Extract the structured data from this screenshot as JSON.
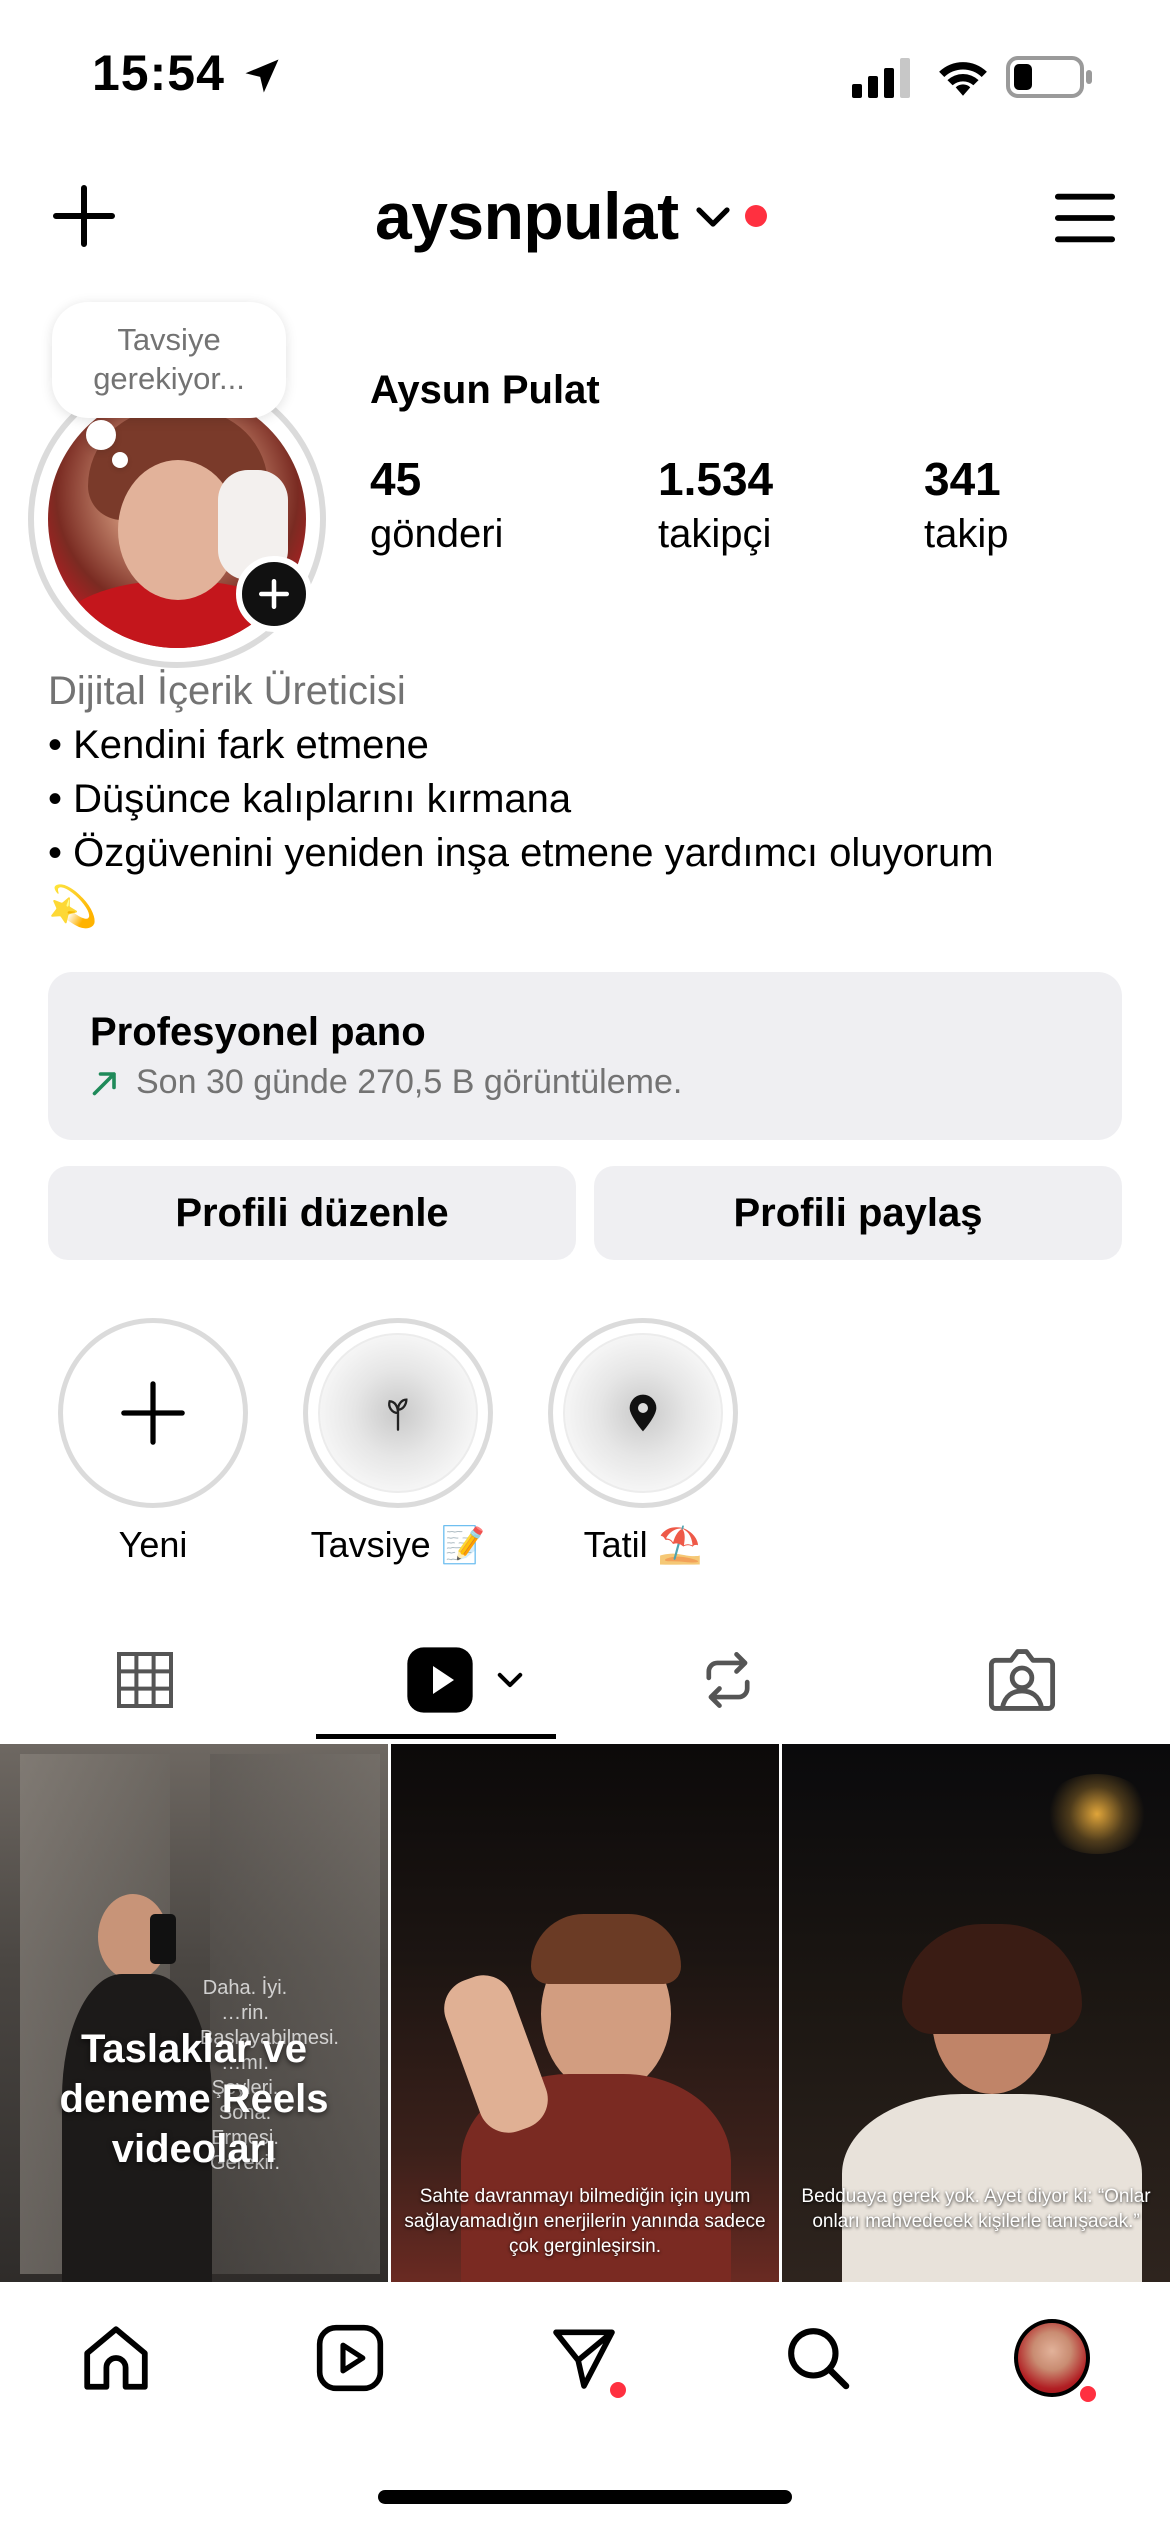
{
  "status_bar": {
    "time": "15:54"
  },
  "header": {
    "username": "aysnpulat"
  },
  "profile": {
    "note": "Tavsiye gerekiyor...",
    "display_name": "Aysun Pulat",
    "stats": [
      {
        "value": "45",
        "label": "gönderi"
      },
      {
        "value": "1.534",
        "label": "takipçi"
      },
      {
        "value": "341",
        "label": "takip"
      }
    ],
    "bio": {
      "category": "Dijital İçerik Üreticisi",
      "lines": [
        "• Kendini fark etmene",
        "• Düşünce kalıplarını kırmana",
        "• Özgüvenini yeniden inşa etmene yardımcı oluyorum"
      ],
      "emoji": "💫"
    }
  },
  "dashboard": {
    "title": "Profesyonel pano",
    "subtitle": "Son 30 günde 270,5 B görüntüleme."
  },
  "buttons": {
    "edit_profile": "Profili düzenle",
    "share_profile": "Profili paylaş"
  },
  "highlights": [
    {
      "label": "Yeni",
      "icon": "plus-icon"
    },
    {
      "label": "Tavsiye 📝",
      "icon": "plant-icon"
    },
    {
      "label": "Tatil ⛱️",
      "icon": "location-pin-icon"
    }
  ],
  "tabs": [
    {
      "name": "grid",
      "icon": "grid-icon",
      "active": false
    },
    {
      "name": "reels",
      "icon": "reels-icon",
      "active": true
    },
    {
      "name": "reposts",
      "icon": "repost-icon",
      "active": false
    },
    {
      "name": "tagged",
      "icon": "tagged-icon",
      "active": false
    }
  ],
  "grid": [
    {
      "overlay": "Taslaklar ve deneme Reels videoları",
      "side_text": "Daha. İyi. …rin. Başlayabilmesi. …mı. Şeyleri. Sona. Ermesi. Gerekir."
    },
    {
      "caption": "Sahte davranmayı bilmediğin için uyum sağlayamadığın enerjilerin yanında sadece çok gerginleşirsin."
    },
    {
      "caption": "Bedduaya gerek yok. Ayet diyor ki: “Onlar onları mahvedecek kişilerle tanışacak.”"
    }
  ],
  "bottom_nav": [
    {
      "name": "home",
      "icon": "home-icon"
    },
    {
      "name": "reels",
      "icon": "reels-nav-icon"
    },
    {
      "name": "messages",
      "icon": "paper-plane-icon"
    },
    {
      "name": "search",
      "icon": "search-icon"
    },
    {
      "name": "profile",
      "icon": "avatar"
    }
  ],
  "colors": {
    "notification_red": "#ff3040",
    "secondary_text": "#737373",
    "button_bg": "#efeff2",
    "trend_arrow": "#1f8a5a"
  }
}
